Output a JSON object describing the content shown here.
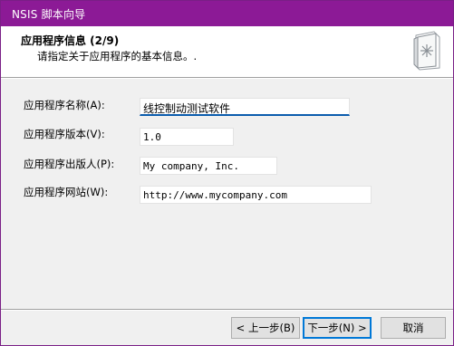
{
  "window": {
    "title": "NSIS 脚本向导"
  },
  "header": {
    "title": "应用程序信息 (2/9)",
    "subtitle": "请指定关于应用程序的基本信息。.",
    "icon": "setup-book-icon"
  },
  "form": {
    "fields": [
      {
        "label": "应用程序名称(A):",
        "value": "线控制动测试软件"
      },
      {
        "label": "应用程序版本(V):",
        "value": "1.0"
      },
      {
        "label": "应用程序出版人(P):",
        "value": "My company, Inc."
      },
      {
        "label": "应用程序网站(W):",
        "value": "http://www.mycompany.com"
      }
    ]
  },
  "buttons": {
    "back": "< 上一步(B)",
    "next": "下一步(N) >",
    "cancel": "取消"
  },
  "colors": {
    "titlebar": "#8c1a96",
    "focus": "#0b5cad"
  }
}
